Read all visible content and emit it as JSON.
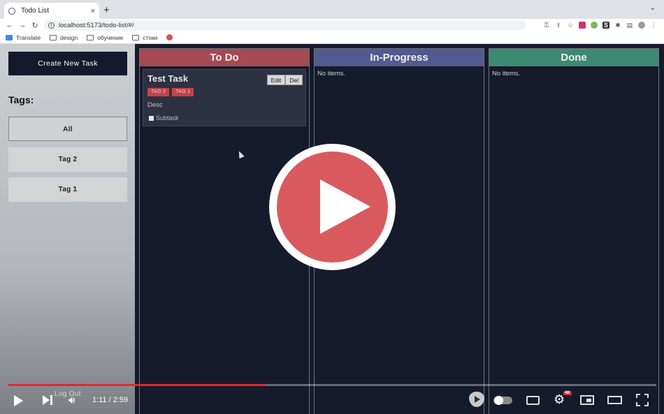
{
  "browser": {
    "tab_title": "Todo List",
    "tab_close": "×",
    "new_tab": "+",
    "url": "localhost:5173/todo-list/#/",
    "back": "←",
    "forward": "→",
    "reload": "↻",
    "bookmarks": [
      {
        "label": "Translate",
        "icon": "translate-icon"
      },
      {
        "label": "design",
        "icon": "folder-icon"
      },
      {
        "label": "обучение",
        "icon": "folder-icon"
      },
      {
        "label": "стоки",
        "icon": "folder-icon"
      }
    ]
  },
  "sidebar": {
    "create_label": "Create New Task",
    "tags_heading": "Tags:",
    "tags": [
      "All",
      "Tag 2",
      "Tag 1"
    ],
    "logout_label": "Log Out"
  },
  "columns": [
    {
      "title": "To Do",
      "color": "#a64a52"
    },
    {
      "title": "In-Progress",
      "color": "#525a91",
      "empty": "No items."
    },
    {
      "title": "Done",
      "color": "#3c8a72",
      "empty": "No items."
    }
  ],
  "task": {
    "title": "Test Task",
    "edit_label": "Edit",
    "delete_label": "Del",
    "tags": [
      "TAG 2",
      "TAG 1"
    ],
    "description": "Desc",
    "subtask": "Subtask"
  },
  "video": {
    "time": "1:11 / 2:59",
    "progress": 0.397,
    "hd_badge": "4K",
    "accent": "#e0282f"
  }
}
